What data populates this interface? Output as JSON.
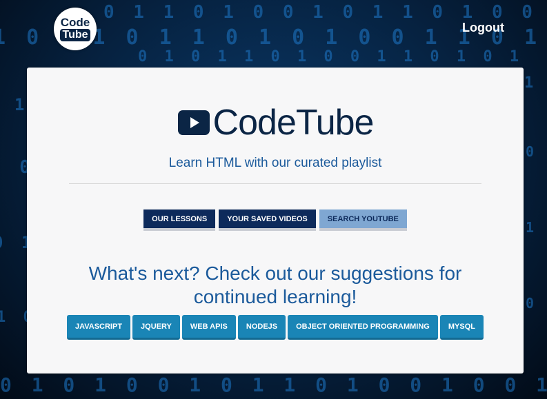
{
  "header": {
    "logo": {
      "line1": "Code",
      "line2": "Tube"
    },
    "logout_label": "Logout"
  },
  "card": {
    "brand_name": "CodeTube",
    "brand_icon": "play-button-icon",
    "tagline": "Learn HTML with our curated playlist",
    "nav": [
      {
        "label": "OUR LESSONS",
        "active": false
      },
      {
        "label": "YOUR SAVED VIDEOS",
        "active": false
      },
      {
        "label": "SEARCH YOUTUBE",
        "active": true
      }
    ],
    "suggestions_title": "What's next? Check out our suggestions for continued learning!",
    "topics": [
      "JAVASCRIPT",
      "JQUERY",
      "WEB APIS",
      "NODEJS",
      "OBJECT ORIENTED PROGRAMMING",
      "MYSQL"
    ]
  },
  "colors": {
    "navy": "#0d2a5b",
    "accent_blue": "#1b5a9b",
    "topic_button": "#1a85b6",
    "active_nav": "#7fa7d2"
  }
}
